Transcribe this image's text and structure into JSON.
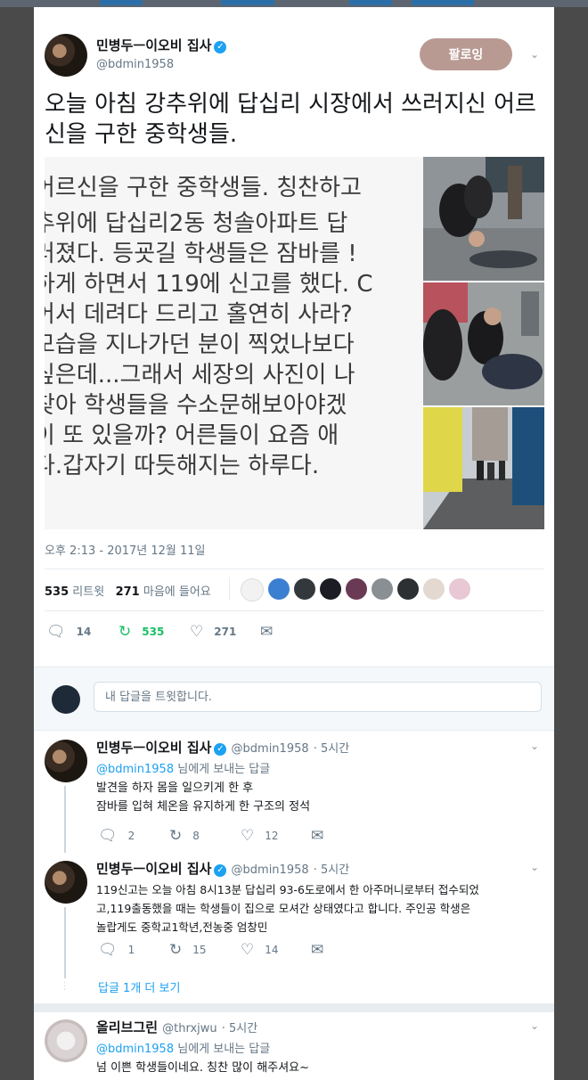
{
  "main_tweet": {
    "author_name": "민병두ㅡ이오비 집사",
    "author_handle": "@bdmin1958",
    "follow_label": "팔로잉",
    "text": "오늘 아침 강추위에 답십리 시장에서 쓰러지신 어르신을 구한 중학생들.",
    "image_text_lines": [
      "어르신을 구한 중학생들. 칭찬하고",
      "추위에 답십리2동 청솔아파트 답",
      "러졌다. 등굣길 학생들은 잠바를 !",
      "하게 하면서 119에 신고를 했다. C",
      "어서 데려다 드리고 홀연히 사라?",
      "모습을 지나가던 분이 찍었나보다",
      "싶은데...그래서 세장의 사진이 나",
      "찾아 학생들을 수소문해보아야겠",
      "이 또 있을까? 어른들이 요즘 애",
      "다.갑자기 따듯해지는 하루다."
    ],
    "timestamp": "오후 2:13 - 2017년 12월 11일",
    "retweets_count": "535",
    "retweets_label": "리트윗",
    "likes_count": "271",
    "likes_label": "마음에 들어요",
    "action_replies": "14",
    "action_retweets": "535",
    "action_likes": "271"
  },
  "reply_box": {
    "placeholder": "내 답글을 트윗합니다."
  },
  "replies": [
    {
      "author_name": "민병두ㅡ이오비 집사",
      "author_handle": "@bdmin1958",
      "time": "· 5시간",
      "reply_to_handle": "@bdmin1958",
      "reply_to_suffix": " 님에게 보내는 답글",
      "lines": [
        "발견을 하자 몸을 일으키게 한 후",
        "잠바를 입혀 체온을 유지하게 한 구조의 정석"
      ],
      "replies": "2",
      "retweets": "8",
      "likes": "12"
    },
    {
      "author_name": "민병두ㅡ이오비 집사",
      "author_handle": "@bdmin1958",
      "time": "· 5시간",
      "lines": [
        "119신고는 오늘 아침 8시13분  답십리 93-6도로에서 한 아주머니로부터 접수되었",
        "고,119출동했을 때는 학생들이 집으로 모셔간 상태였다고 합니다. 주인공 학생은",
        "놀랍게도 중학교1학년,전농중 엄창민"
      ],
      "replies": "1",
      "retweets": "15",
      "likes": "14",
      "more_replies": "답글 1개 더 보기"
    },
    {
      "author_name": "올리브그린",
      "author_handle": "@thrxjwu",
      "time": "· 5시간",
      "reply_to_handle": "@bdmin1958",
      "reply_to_suffix": " 님에게 보내는 답글",
      "lines": [
        "넘 이쁜 학생들이네요. 칭찬 많이 해주셔요~"
      ]
    }
  ],
  "colors": {
    "accent": "#1da1f2",
    "retweet": "#17bf63",
    "follow_button": "#b99a93",
    "secondary_text": "#657786"
  },
  "icons": {
    "reply": "speech-bubble-icon",
    "retweet": "retweet-arrows-icon",
    "like": "heart-icon",
    "message": "envelope-icon",
    "verified": "verified-badge-icon",
    "more": "chevron-down-icon"
  }
}
